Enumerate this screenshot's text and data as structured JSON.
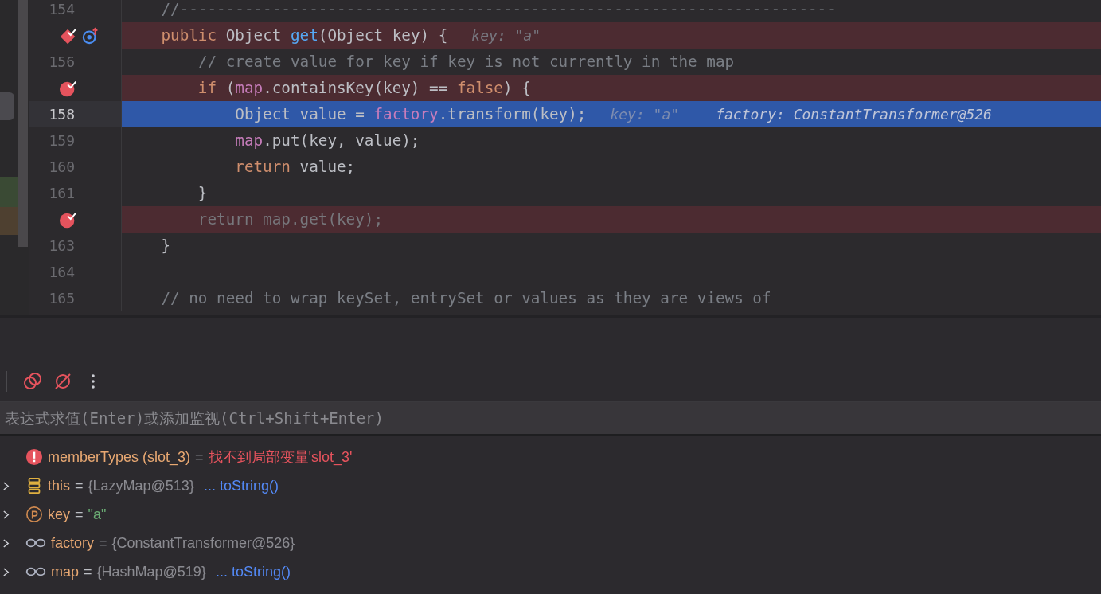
{
  "editor": {
    "lines": [
      {
        "number": "154",
        "kind": "plain",
        "selected": false,
        "tokens": [
          {
            "text": "    //-----------------------------------------------------------------------",
            "kind": "comment"
          }
        ]
      },
      {
        "kind": "method_breakpoint",
        "selected": false,
        "tokens": [
          {
            "text": "    public ",
            "kind": "keyword"
          },
          {
            "text": "Object ",
            "kind": "plain"
          },
          {
            "text": "get",
            "kind": "method"
          },
          {
            "text": "(Object key) {",
            "kind": "plain"
          }
        ],
        "hints": [
          {
            "text": "key: \"a\"",
            "kind": "hint"
          }
        ]
      },
      {
        "number": "156",
        "kind": "plain",
        "selected": false,
        "tokens": [
          {
            "text": "        // create value for key if key is not currently in the map",
            "kind": "comment"
          }
        ]
      },
      {
        "kind": "breakpoint",
        "selected": false,
        "tokens": [
          {
            "text": "        if ",
            "kind": "keyword"
          },
          {
            "text": "(",
            "kind": "plain"
          },
          {
            "text": "map",
            "kind": "field"
          },
          {
            "text": ".containsKey(key) == ",
            "kind": "plain"
          },
          {
            "text": "false",
            "kind": "keyword"
          },
          {
            "text": ") {",
            "kind": "plain"
          }
        ]
      },
      {
        "number": "158",
        "kind": "plain",
        "selected": true,
        "tokens": [
          {
            "text": "            Object value = ",
            "kind": "plain"
          },
          {
            "text": "factory",
            "kind": "field"
          },
          {
            "text": ".transform(key);",
            "kind": "plain"
          }
        ],
        "hints": [
          {
            "text": "key: \"a\"",
            "kind": "hint"
          },
          {
            "text": "factory: ConstantTransformer@526",
            "kind": "value"
          }
        ]
      },
      {
        "number": "159",
        "kind": "plain",
        "selected": false,
        "tokens": [
          {
            "text": "            map",
            "kind": "field"
          },
          {
            "text": ".put(key, value);",
            "kind": "plain"
          }
        ]
      },
      {
        "number": "160",
        "kind": "plain",
        "selected": false,
        "tokens": [
          {
            "text": "            return ",
            "kind": "keyword"
          },
          {
            "text": "value;",
            "kind": "plain"
          }
        ]
      },
      {
        "number": "161",
        "kind": "plain",
        "selected": false,
        "tokens": [
          {
            "text": "        }",
            "kind": "plain"
          }
        ]
      },
      {
        "kind": "breakpoint",
        "selected": false,
        "tokens": [
          {
            "text": "        return map.get(key);",
            "kind": "dim"
          }
        ]
      },
      {
        "number": "163",
        "kind": "plain",
        "selected": false,
        "tokens": [
          {
            "text": "    }",
            "kind": "plain"
          }
        ]
      },
      {
        "number": "164",
        "kind": "plain",
        "selected": false
      },
      {
        "number": "165",
        "kind": "plain",
        "selected": false,
        "tokens": [
          {
            "text": "    // no need to wrap keySet, entrySet or values as they are views of",
            "kind": "comment"
          }
        ]
      }
    ]
  },
  "debugger": {
    "evaluate_field": {
      "placeholder": "表达式求值(Enter)或添加监视(Ctrl+Shift+Enter)"
    },
    "variables": [
      {
        "kind": "error",
        "expandable": false,
        "name": "memberTypes (slot_3)",
        "separator": "=",
        "value": {
          "text": "找不到局部变量'slot_3'",
          "kind": "error"
        }
      },
      {
        "kind": "object",
        "expandable": true,
        "name": "this",
        "separator": "=",
        "value": {
          "text": "{LazyMap@513}",
          "kind": "object"
        },
        "link": "... toString()"
      },
      {
        "kind": "param",
        "expandable": true,
        "name": "key",
        "separator": "=",
        "value": {
          "text": "\"a\"",
          "kind": "string"
        }
      },
      {
        "kind": "watch",
        "expandable": true,
        "name": "factory",
        "separator": "=",
        "value": {
          "text": "{ConstantTransformer@526}",
          "kind": "object"
        }
      },
      {
        "kind": "watch",
        "expandable": true,
        "name": "map",
        "separator": "=",
        "value": {
          "text": "{HashMap@519}",
          "kind": "object"
        },
        "link": "... toString()"
      }
    ]
  }
}
